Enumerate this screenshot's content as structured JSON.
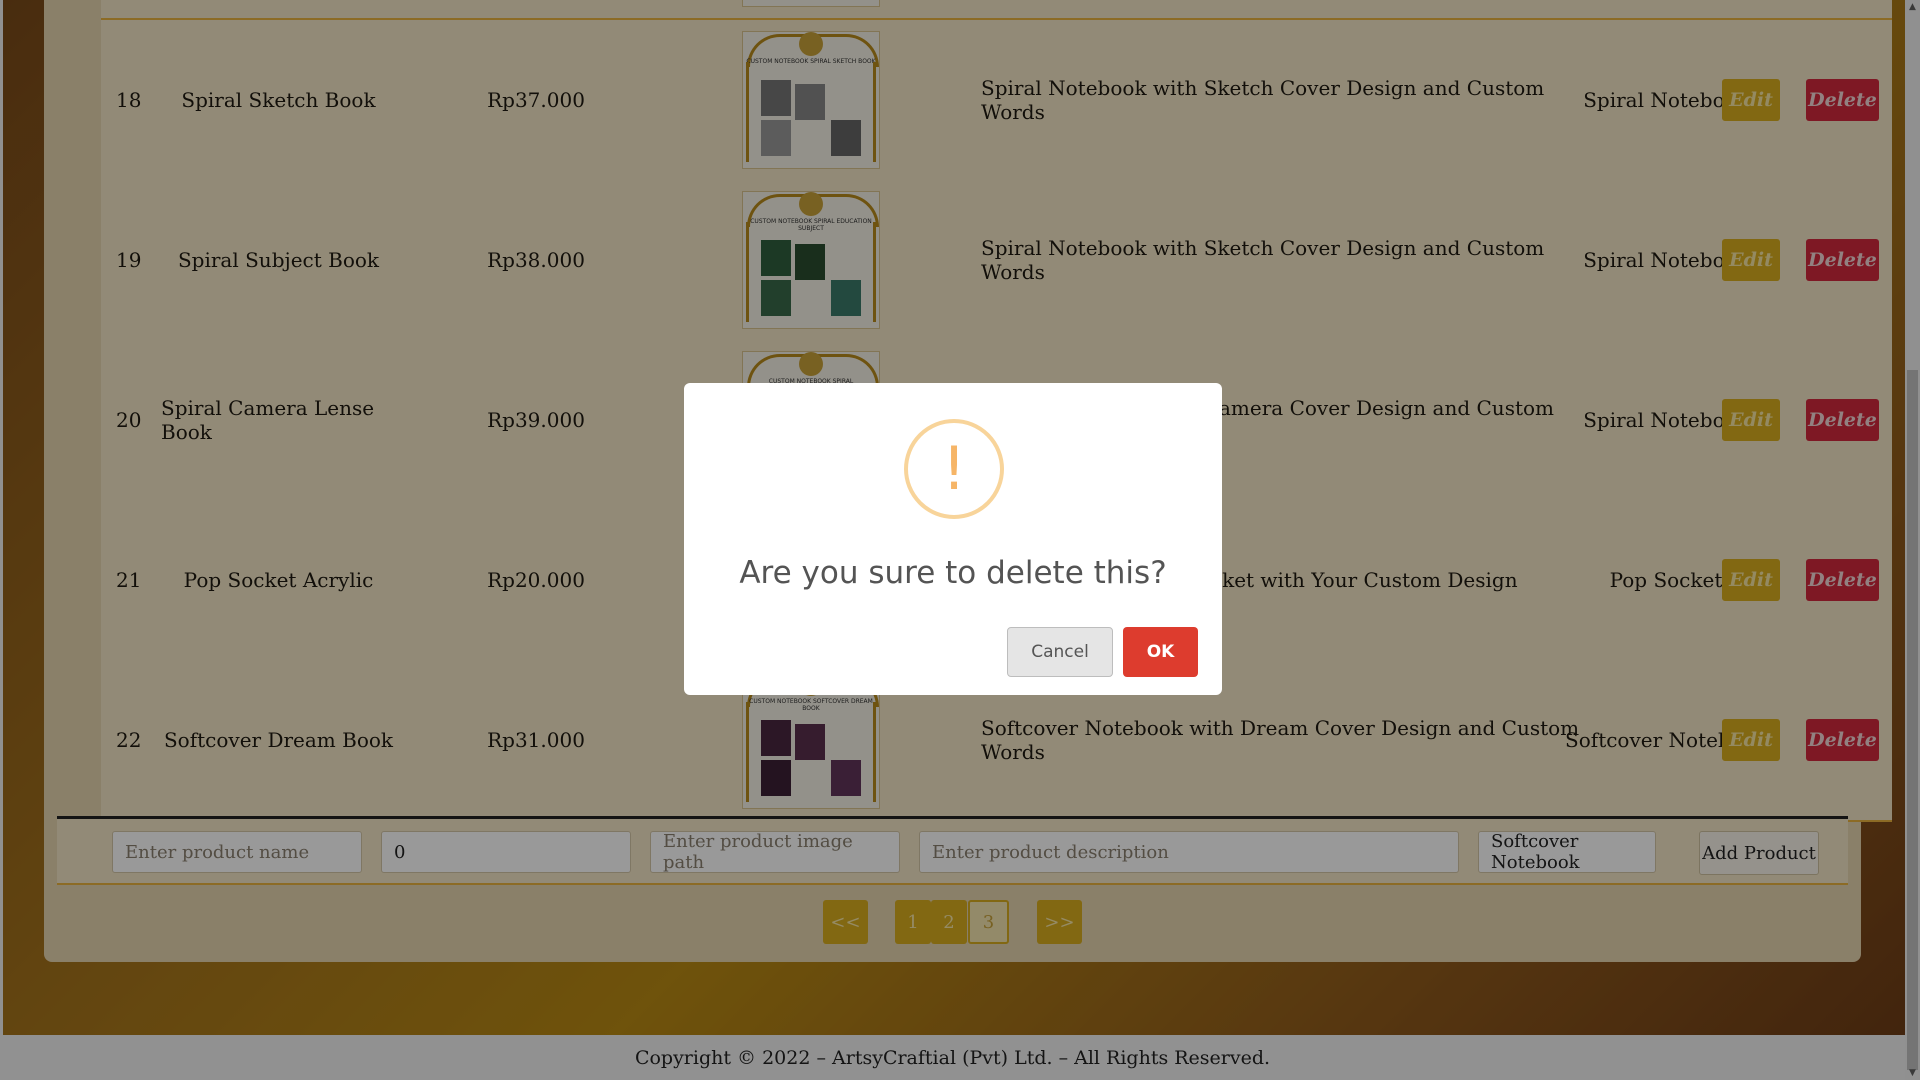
{
  "rows": [
    {
      "id": "18",
      "name": "Spiral Sketch Book",
      "price": "Rp37.000",
      "image_title": "CUSTOM NOTEBOOK SPIRAL SKETCH BOOK",
      "description": "Spiral Notebook with Sketch Cover Design and Custom Words",
      "category": "Spiral Notebook"
    },
    {
      "id": "19",
      "name": "Spiral Subject Book",
      "price": "Rp38.000",
      "image_title": "CUSTOM NOTEBOOK SPIRAL EDUCATION SUBJECT",
      "description": "Spiral Notebook with Sketch Cover Design and Custom Words",
      "category": "Spiral Notebook"
    },
    {
      "id": "20",
      "name": "Spiral Camera Lense Book",
      "price": "Rp39.000",
      "image_title": "CUSTOM NOTEBOOK SPIRAL",
      "description": "Spiral Notebook with Camera Cover Design and Custom Words",
      "category": "Spiral Notebook"
    },
    {
      "id": "21",
      "name": "Pop Socket Acrylic",
      "price": "Rp20.000",
      "image_title": "",
      "description": "Acrylic Pop Socket with Your Custom Design",
      "category": "Pop Socket"
    },
    {
      "id": "22",
      "name": "Softcover Dream Book",
      "price": "Rp31.000",
      "image_title": "CUSTOM NOTEBOOK SOFTCOVER DREAM BOOK",
      "description": "Softcover Notebook with Dream Cover Design and Custom Words",
      "category": "Softcover Notebook"
    }
  ],
  "row_actions": {
    "edit_label": "Edit",
    "delete_label": "Delete"
  },
  "add_form": {
    "name_placeholder": "Enter product name",
    "price_value": "0",
    "image_placeholder": "Enter product image path",
    "description_placeholder": "Enter product description",
    "category_value": "Softcover Notebook",
    "add_label": "Add Product"
  },
  "pagination": {
    "first": "<<",
    "pages": [
      "1",
      "2",
      "3"
    ],
    "active_page": "3",
    "last": ">>"
  },
  "footer": {
    "text": "Copyright © 2022 – ArtsyCraftial (Pvt) Ltd. – All Rights Reserved."
  },
  "dialog": {
    "icon": "warning-icon",
    "symbol": "!",
    "title": "Are you sure to delete this?",
    "cancel_label": "Cancel",
    "ok_label": "OK"
  },
  "colors": {
    "edit": "#d9ad1e",
    "delete": "#d2283c",
    "ok": "#dd3c2e",
    "warning": "#f8d49a"
  }
}
